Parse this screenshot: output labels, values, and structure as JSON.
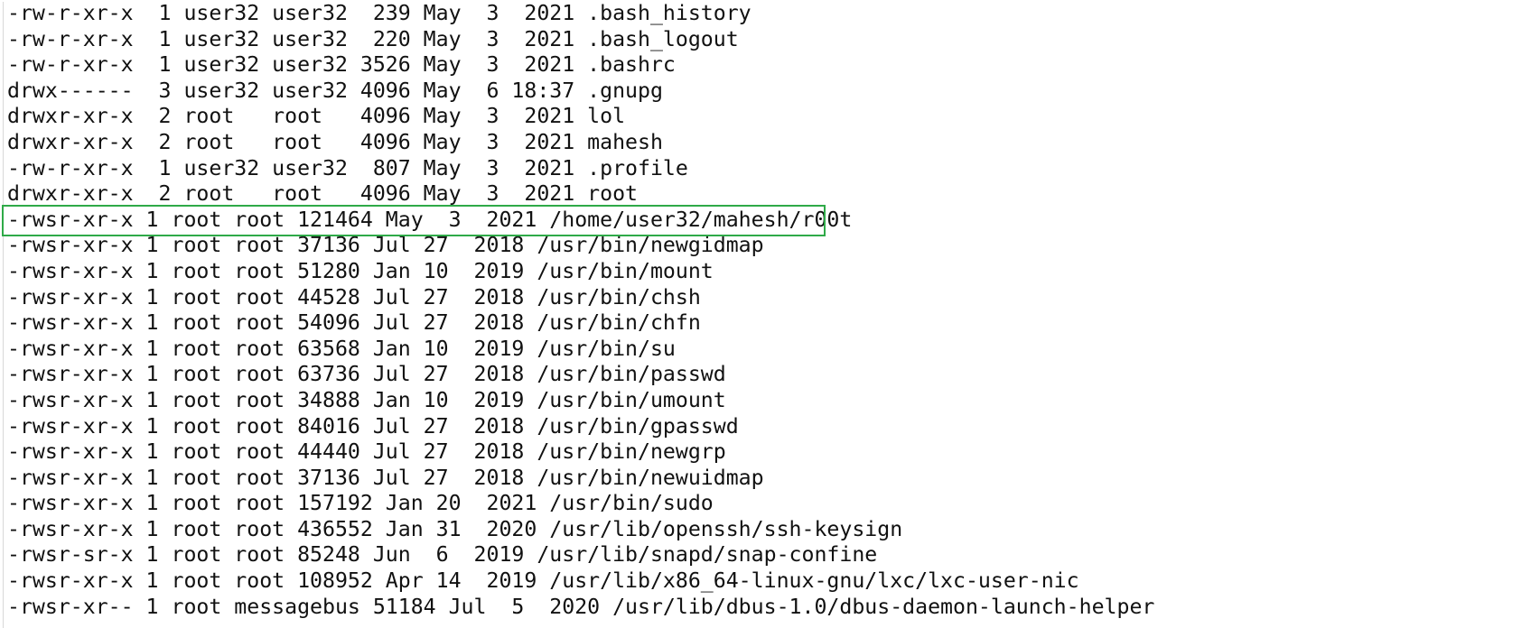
{
  "terminal": {
    "lines": [
      "-rw-r-xr-x  1 user32 user32  239 May  3  2021 .bash_history",
      "-rw-r-xr-x  1 user32 user32  220 May  3  2021 .bash_logout",
      "-rw-r-xr-x  1 user32 user32 3526 May  3  2021 .bashrc",
      "drwx------  3 user32 user32 4096 May  6 18:37 .gnupg",
      "drwxr-xr-x  2 root   root   4096 May  3  2021 lol",
      "drwxr-xr-x  2 root   root   4096 May  3  2021 mahesh",
      "-rw-r-xr-x  1 user32 user32  807 May  3  2021 .profile",
      "drwxr-xr-x  2 root   root   4096 May  3  2021 root",
      "-rwsr-xr-x 1 root root 121464 May  3  2021 /home/user32/mahesh/r00t",
      "-rwsr-xr-x 1 root root 37136 Jul 27  2018 /usr/bin/newgidmap",
      "-rwsr-xr-x 1 root root 51280 Jan 10  2019 /usr/bin/mount",
      "-rwsr-xr-x 1 root root 44528 Jul 27  2018 /usr/bin/chsh",
      "-rwsr-xr-x 1 root root 54096 Jul 27  2018 /usr/bin/chfn",
      "-rwsr-xr-x 1 root root 63568 Jan 10  2019 /usr/bin/su",
      "-rwsr-xr-x 1 root root 63736 Jul 27  2018 /usr/bin/passwd",
      "-rwsr-xr-x 1 root root 34888 Jan 10  2019 /usr/bin/umount",
      "-rwsr-xr-x 1 root root 84016 Jul 27  2018 /usr/bin/gpasswd",
      "-rwsr-xr-x 1 root root 44440 Jul 27  2018 /usr/bin/newgrp",
      "-rwsr-xr-x 1 root root 37136 Jul 27  2018 /usr/bin/newuidmap",
      "-rwsr-xr-x 1 root root 157192 Jan 20  2021 /usr/bin/sudo",
      "-rwsr-xr-x 1 root root 436552 Jan 31  2020 /usr/lib/openssh/ssh-keysign",
      "-rwsr-sr-x 1 root root 85248 Jun  6  2019 /usr/lib/snapd/snap-confine",
      "-rwsr-xr-x 1 root root 108952 Apr 14  2019 /usr/lib/x86_64-linux-gnu/lxc/lxc-user-nic",
      "-rwsr-xr-- 1 root messagebus 51184 Jul  5  2020 /usr/lib/dbus-1.0/dbus-daemon-launch-helper"
    ],
    "highlight_color": "#2faa48"
  }
}
